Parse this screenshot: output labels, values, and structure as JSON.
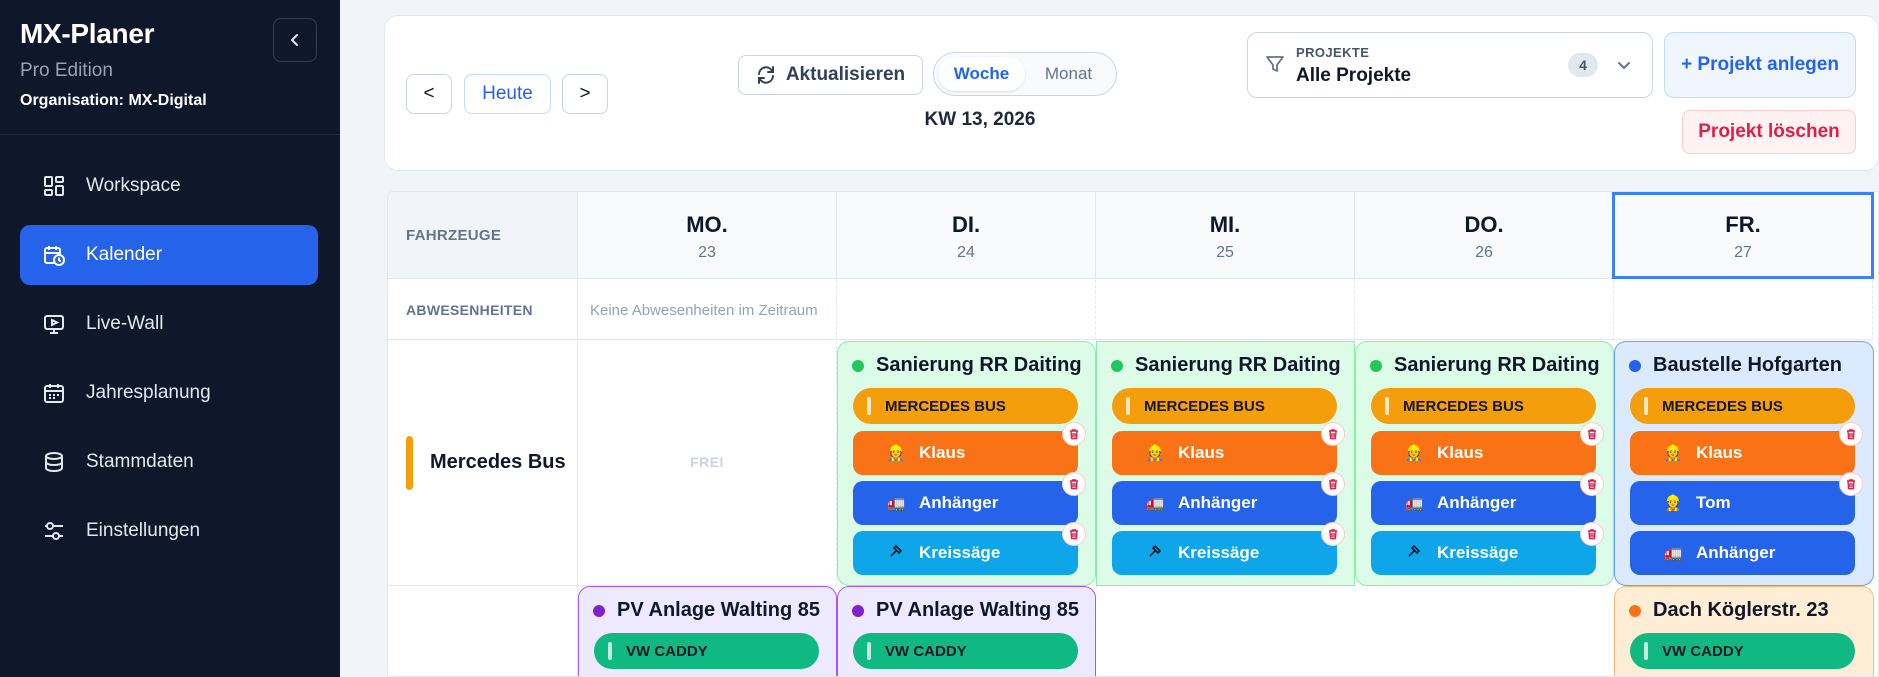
{
  "app": {
    "title": "MX-Planer",
    "edition": "Pro Edition",
    "organization": "Organisation: MX-Digital"
  },
  "sidebar": {
    "items": [
      {
        "label": "Workspace",
        "icon": "grid-icon",
        "active": false
      },
      {
        "label": "Kalender",
        "icon": "calendar-clock-icon",
        "active": true
      },
      {
        "label": "Live-Wall",
        "icon": "monitor-play-icon",
        "active": false
      },
      {
        "label": "Jahresplanung",
        "icon": "calendar-icon",
        "active": false
      },
      {
        "label": "Stammdaten",
        "icon": "database-icon",
        "active": false
      },
      {
        "label": "Einstellungen",
        "icon": "sliders-icon",
        "active": false
      }
    ]
  },
  "toolbar": {
    "prev_label": "<",
    "today_label": "Heute",
    "next_label": ">",
    "refresh_label": "Aktualisieren",
    "view_week": "Woche",
    "view_month": "Monat",
    "week_label": "KW 13, 2026",
    "filter_label": "PROJEKTE",
    "filter_value": "Alle Projekte",
    "filter_count": "4",
    "add_project": "+ Projekt anlegen",
    "delete_project": "Projekt löschen"
  },
  "calendar": {
    "vehicles_header": "FAHRZEUGE",
    "absences_header": "ABWESENHEITEN",
    "absences_empty": "Keine Abwesenheiten im Zeitraum",
    "free_label": "FREI",
    "days": [
      {
        "name": "MO.",
        "date": "23"
      },
      {
        "name": "DI.",
        "date": "24"
      },
      {
        "name": "MI.",
        "date": "25"
      },
      {
        "name": "DO.",
        "date": "26"
      },
      {
        "name": "FR.",
        "date": "27"
      }
    ],
    "vehicles": [
      {
        "name": "Mercedes Bus"
      }
    ],
    "projects": [
      {
        "title": "Sanierung RR Daiting",
        "vehicle": "MERCEDES BUS",
        "resources": [
          "Klaus",
          "Anhänger",
          "Kreissäge"
        ]
      },
      {
        "title": "Sanierung RR Daiting",
        "vehicle": "MERCEDES BUS",
        "resources": [
          "Klaus",
          "Anhänger",
          "Kreissäge"
        ]
      },
      {
        "title": "Sanierung RR Daiting",
        "vehicle": "MERCEDES BUS",
        "resources": [
          "Klaus",
          "Anhänger",
          "Kreissäge"
        ]
      },
      {
        "title": "Baustelle Hofgarten",
        "vehicle": "MERCEDES BUS",
        "resources": [
          "Klaus",
          "Tom",
          "Anhänger"
        ]
      },
      {
        "title": "PV Anlage Walting 85",
        "vehicle": "VW CADDY"
      },
      {
        "title": "PV Anlage Walting 85",
        "vehicle": "VW CADDY"
      },
      {
        "title": "Dach Köglerstr. 23",
        "vehicle": "VW CADDY"
      }
    ]
  },
  "colors": {
    "sidebar_bg": "#0f172a",
    "accent": "#2563eb",
    "vehicle_pill_orange": "#f59e0b",
    "worker_orange": "#f97316",
    "trailer_blue": "#2563eb",
    "tool_cyan": "#0ea5e9",
    "caddy_green": "#10b981",
    "danger": "#e11d48"
  }
}
